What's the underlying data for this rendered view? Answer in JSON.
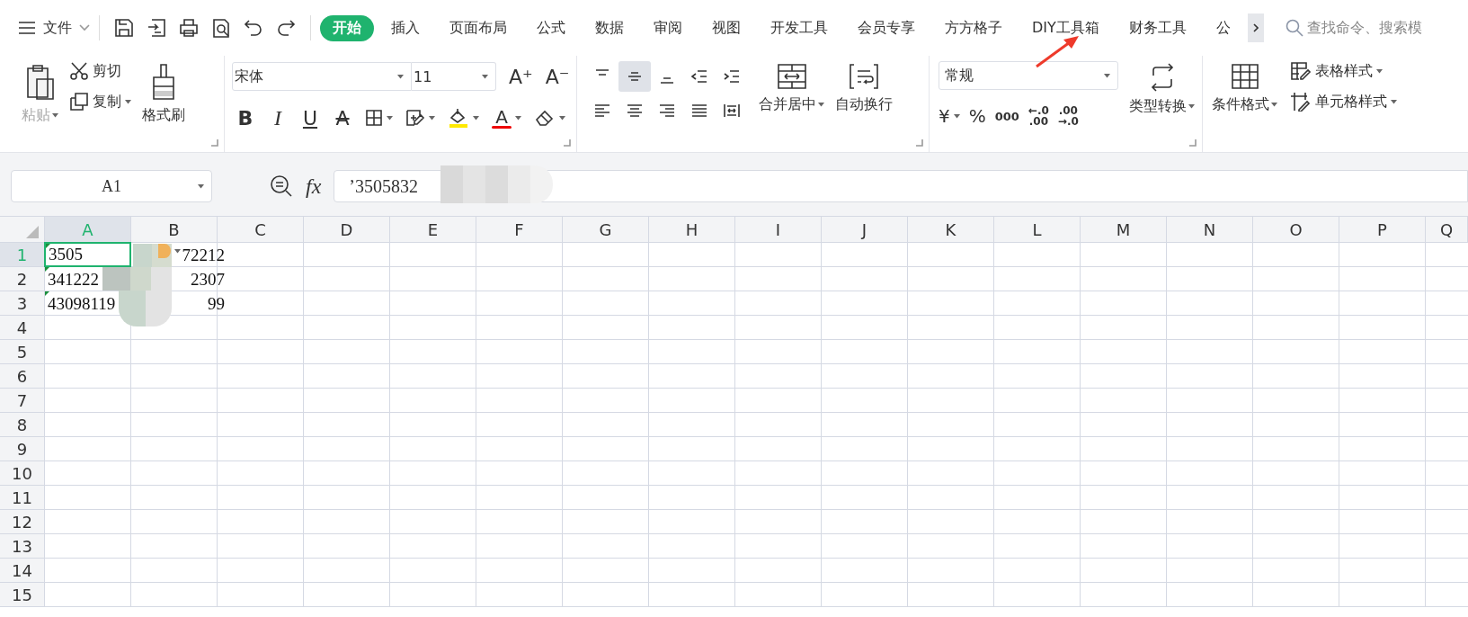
{
  "menubar": {
    "file_label": "文件",
    "tabs": [
      {
        "label": "开始",
        "selected": true
      },
      {
        "label": "插入",
        "selected": false
      },
      {
        "label": "页面布局",
        "selected": false
      },
      {
        "label": "公式",
        "selected": false
      },
      {
        "label": "数据",
        "selected": false
      },
      {
        "label": "审阅",
        "selected": false
      },
      {
        "label": "视图",
        "selected": false
      },
      {
        "label": "开发工具",
        "selected": false
      },
      {
        "label": "会员专享",
        "selected": false
      },
      {
        "label": "方方格子",
        "selected": false
      },
      {
        "label": "DIY工具箱",
        "selected": false
      },
      {
        "label": "财务工具",
        "selected": false
      },
      {
        "label": "公",
        "selected": false
      }
    ],
    "search_placeholder": "查找命令、搜索模"
  },
  "ribbon": {
    "paste": {
      "label": "粘贴",
      "disabled": true
    },
    "cut": "剪切",
    "copy": "复制",
    "format_painter": "格式刷",
    "font_name": "宋体",
    "font_size": "11",
    "grow_font": "A⁺",
    "shrink_font": "A⁻",
    "font_styles": [
      {
        "kind": "bold",
        "glyph": "B"
      },
      {
        "kind": "italic",
        "glyph": "I"
      },
      {
        "kind": "underline",
        "glyph": "U"
      },
      {
        "kind": "strike",
        "glyph": "A"
      }
    ],
    "font_color_glyph": "A",
    "align_buttons": [
      {
        "kind": "top",
        "selected": false
      },
      {
        "kind": "middle",
        "selected": true
      },
      {
        "kind": "bottom",
        "selected": false
      },
      {
        "kind": "outdent",
        "selected": false
      },
      {
        "kind": "indent",
        "selected": false
      },
      {
        "kind": "left",
        "selected": false
      },
      {
        "kind": "center",
        "selected": false
      },
      {
        "kind": "right",
        "selected": false
      },
      {
        "kind": "justify",
        "selected": false
      },
      {
        "kind": "distributed",
        "selected": false
      }
    ],
    "merge": "合并居中",
    "wrap": "自动换行",
    "number_format": "常规",
    "currency": "¥",
    "percent": "%",
    "thousands": "000",
    "add_decimal": [
      "←.0",
      ".00"
    ],
    "remove_decimal": [
      ".00",
      "→.0"
    ],
    "convert": "类型转换",
    "conditional": "条件格式",
    "table_style": "表格样式",
    "cell_style": "单元格样式"
  },
  "formula_bar": {
    "name_box": "A1",
    "fx": "fx",
    "formula": "’3505832"
  },
  "sheet": {
    "columns": [
      {
        "label": "A",
        "selected": true
      },
      {
        "label": "B",
        "selected": false
      },
      {
        "label": "C",
        "selected": false
      },
      {
        "label": "D",
        "selected": false
      },
      {
        "label": "E",
        "selected": false
      },
      {
        "label": "F",
        "selected": false
      },
      {
        "label": "G",
        "selected": false
      },
      {
        "label": "H",
        "selected": false
      },
      {
        "label": "I",
        "selected": false
      },
      {
        "label": "J",
        "selected": false
      },
      {
        "label": "K",
        "selected": false
      },
      {
        "label": "L",
        "selected": false
      },
      {
        "label": "M",
        "selected": false
      },
      {
        "label": "N",
        "selected": false
      },
      {
        "label": "O",
        "selected": false
      },
      {
        "label": "P",
        "selected": false
      },
      {
        "label": "Q",
        "selected": false
      }
    ],
    "rows": [
      {
        "label": "1",
        "selected": true,
        "lead": "3505",
        "tail": "72212"
      },
      {
        "label": "2",
        "selected": false,
        "lead": "341222",
        "tail": "2307"
      },
      {
        "label": "3",
        "selected": false,
        "lead": "43098119",
        "tail": "99"
      },
      {
        "label": "4",
        "selected": false
      },
      {
        "label": "5",
        "selected": false
      },
      {
        "label": "6",
        "selected": false
      },
      {
        "label": "7",
        "selected": false
      },
      {
        "label": "8",
        "selected": false
      },
      {
        "label": "9",
        "selected": false
      },
      {
        "label": "10",
        "selected": false
      },
      {
        "label": "11",
        "selected": false
      },
      {
        "label": "12",
        "selected": false
      },
      {
        "label": "13",
        "selected": false
      },
      {
        "label": "14",
        "selected": false
      },
      {
        "label": "15",
        "selected": false
      }
    ]
  }
}
